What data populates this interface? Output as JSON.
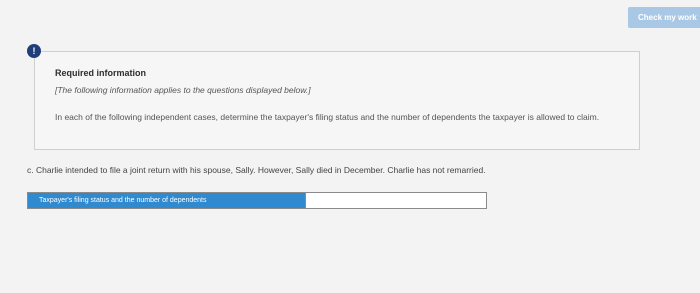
{
  "toolbar": {
    "check_label": "Check my work"
  },
  "alert": {
    "icon_glyph": "!",
    "icon_name": "alert-icon"
  },
  "info": {
    "title": "Required information",
    "note": "[The following information applies to the questions displayed below.]",
    "body": "In each of the following independent cases, determine the taxpayer's filing status and the number of dependents the taxpayer is allowed to claim."
  },
  "question": {
    "text": "c. Charlie intended to file a joint return with his spouse, Sally. However, Sally died in December. Charlie has not remarried."
  },
  "answer": {
    "label": "Taxpayer's filing status and the number of dependents",
    "value": ""
  },
  "colors": {
    "accent": "#2f8ad0",
    "alert": "#1f3e7a",
    "check_button": "#a9c8e6"
  }
}
